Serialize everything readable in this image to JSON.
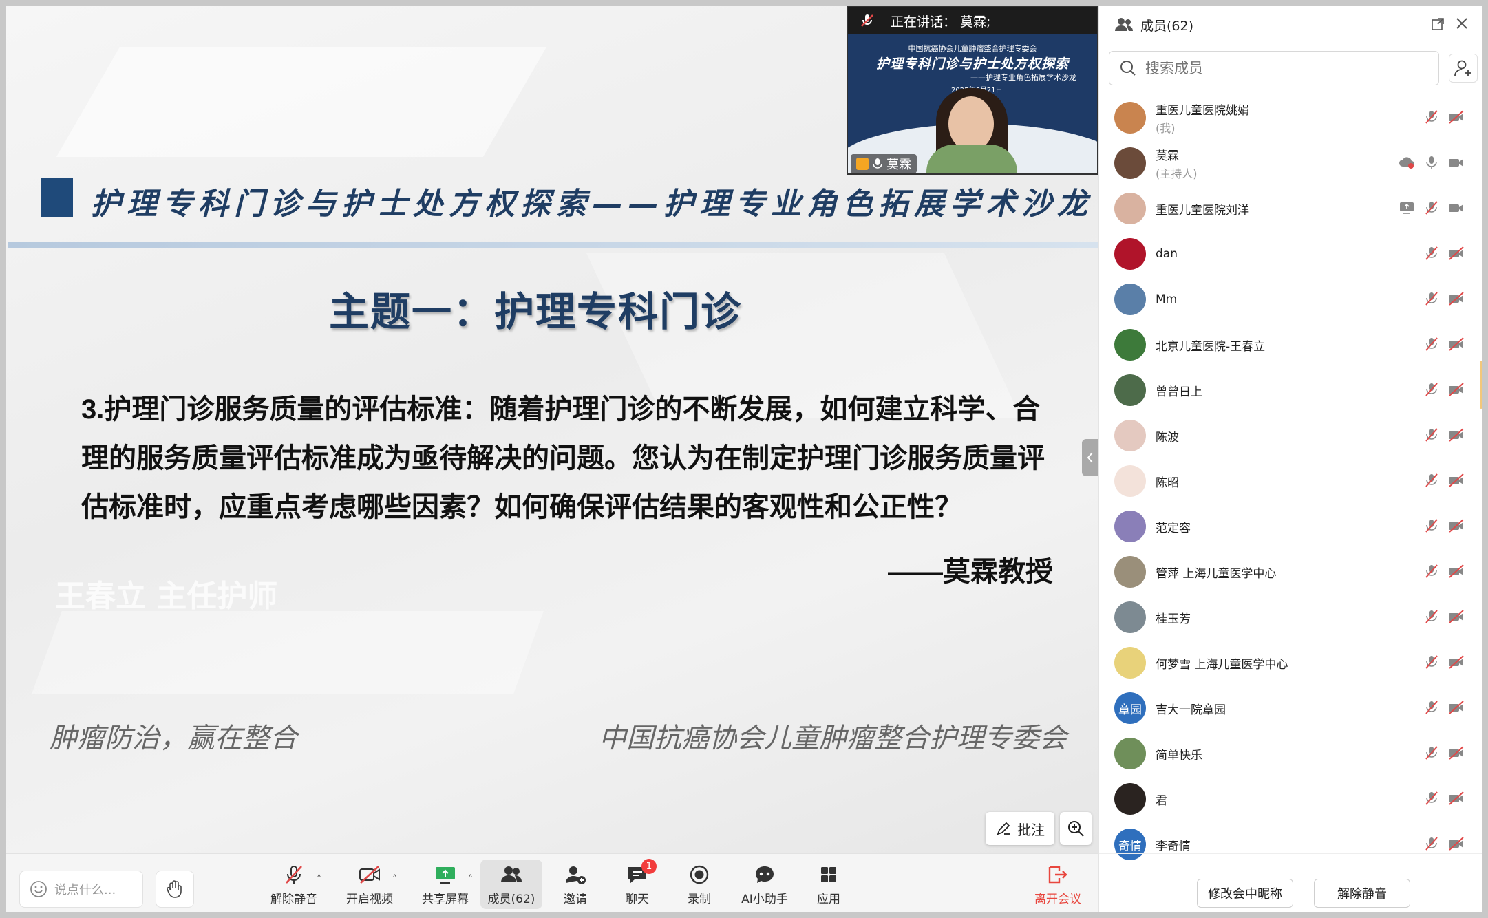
{
  "speaker": {
    "speaking_label": "正在讲话：",
    "speaking_name": "莫霖;",
    "mini_org": "中国抗癌协会儿童肿瘤整合护理专委会",
    "mini_title": "护理专科门诊与护士处方权探索",
    "mini_sub": "——护理专业角色拓展学术沙龙",
    "mini_date": "2025年6月21日",
    "name_tag": "莫霖"
  },
  "slide": {
    "header_title": "护理专科门诊与护士处方权探索——护理专业角色拓展学术沙龙",
    "topic": "主题一：护理专科门诊",
    "question": "3.护理门诊服务质量的评估标准：随着护理门诊的不断发展，如何建立科学、合理的服务质量评估标准成为亟待解决的问题。您认为在制定护理门诊服务质量评估标准时，应重点考虑哪些因素？如何确保评估结果的客观性和公正性？",
    "attribution": "——莫霖教授",
    "watermark": "王春立 主任护师",
    "motto": "肿瘤防治，赢在整合",
    "org": "中国抗癌协会儿童肿瘤整合护理专委会"
  },
  "stage_controls": {
    "annotate_label": "批注"
  },
  "toolbar": {
    "chat_placeholder": "说点什么...",
    "unmute": "解除静音",
    "start_video": "开启视频",
    "share_screen": "共享屏幕",
    "members": "成员(62)",
    "invite": "邀请",
    "chat": "聊天",
    "chat_badge": "1",
    "record": "录制",
    "ai_assistant": "AI小助手",
    "apps": "应用",
    "leave": "离开会议"
  },
  "panel": {
    "title": "成员(62)",
    "search_placeholder": "搜索成员",
    "rename_button": "修改会中昵称",
    "unmute_button": "解除静音",
    "members": [
      {
        "name": "重医儿童医院姚娟",
        "role": "(我)",
        "avatar_color": "#c9844f"
      },
      {
        "name": "莫霖",
        "role": "(主持人)",
        "avatar_color": "#6b4b3a"
      },
      {
        "name": "重医儿童医院刘洋",
        "role": "",
        "avatar_color": "#d9b2a0"
      },
      {
        "name": "dan",
        "role": "",
        "avatar_color": "#b0142a"
      },
      {
        "name": "Mm",
        "role": "",
        "avatar_color": "#5a7fa8"
      },
      {
        "name": "北京儿童医院-王春立",
        "role": "",
        "avatar_color": "#3d7a3a"
      },
      {
        "name": "曾曾日上",
        "role": "",
        "avatar_color": "#4d6b4a"
      },
      {
        "name": "陈波",
        "role": "",
        "avatar_color": "#e4c9c0"
      },
      {
        "name": "陈昭",
        "role": "",
        "avatar_color": "#f3e2da"
      },
      {
        "name": "范定容",
        "role": "",
        "avatar_color": "#8a7fb8"
      },
      {
        "name": "管萍 上海儿童医学中心",
        "role": "",
        "avatar_color": "#9a8f7a"
      },
      {
        "name": "桂玉芳",
        "role": "",
        "avatar_color": "#7d8a92"
      },
      {
        "name": "何梦雪 上海儿童医学中心",
        "role": "",
        "avatar_color": "#e8d27a"
      },
      {
        "name": "吉大一院章园",
        "role": "",
        "avatar_color": "#2f6fbd",
        "avatar_text": "章园"
      },
      {
        "name": "简单快乐",
        "role": "",
        "avatar_color": "#6f8f5a"
      },
      {
        "name": "君",
        "role": "",
        "avatar_color": "#2a2320"
      },
      {
        "name": "李奇情",
        "role": "",
        "avatar_color": "#2f6fbd",
        "avatar_text": "奇情"
      }
    ]
  },
  "colors": {
    "accent_navy": "#1f3d63",
    "leave_red": "#e8473f",
    "muted_red": "#e04848",
    "avatar_blue": "#2f6fbd"
  }
}
